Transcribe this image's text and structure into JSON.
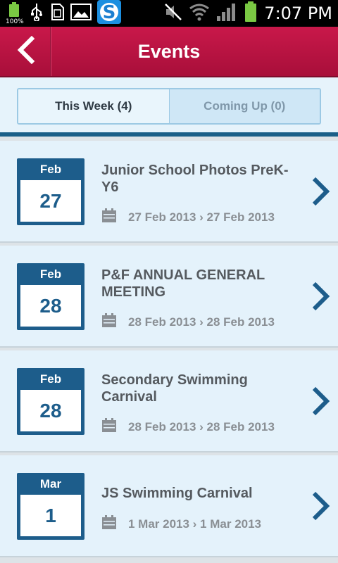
{
  "status_bar": {
    "battery_left_label": "100%",
    "time": "7:07 PM"
  },
  "header": {
    "title": "Events"
  },
  "tabs": [
    {
      "label": "This Week (4)",
      "active": true
    },
    {
      "label": "Coming Up (0)",
      "active": false
    }
  ],
  "events": [
    {
      "month": "Feb",
      "day": "27",
      "title": "Junior School Photos PreK-Y6",
      "dates": "27 Feb 2013 › 27 Feb 2013"
    },
    {
      "month": "Feb",
      "day": "28",
      "title": "P&F ANNUAL GENERAL MEETING",
      "dates": "28 Feb 2013 › 28 Feb 2013"
    },
    {
      "month": "Feb",
      "day": "28",
      "title": "Secondary Swimming Carnival",
      "dates": "28 Feb 2013 › 28 Feb 2013"
    },
    {
      "month": "Mar",
      "day": "1",
      "title": "JS Swimming Carnival",
      "dates": "1 Mar 2013 › 1 Mar 2013"
    }
  ],
  "colors": {
    "app_bar": "#b81442",
    "calendar_blue": "#1d5d8b",
    "row_background": "#e4f2fb"
  }
}
